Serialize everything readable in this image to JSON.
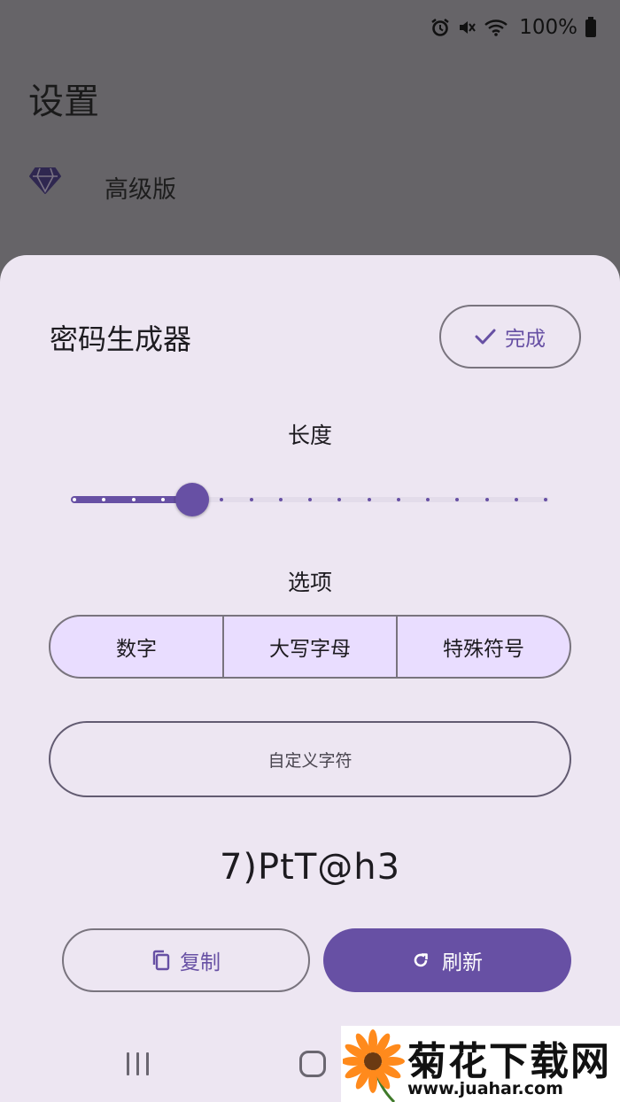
{
  "status_bar": {
    "battery_text": "100%",
    "icons": [
      "alarm-icon",
      "mute-icon",
      "wifi-icon",
      "battery-icon"
    ]
  },
  "settings": {
    "title": "设置",
    "premium_label": "高级版",
    "premium_icon": "diamond-icon"
  },
  "sheet": {
    "title": "密码生成器",
    "done_label": "完成",
    "length_label": "长度",
    "length_slider": {
      "min": 1,
      "max": 17,
      "value": 5
    },
    "options_label": "选项",
    "options": [
      "数字",
      "大写字母",
      "特殊符号"
    ],
    "custom_chars_placeholder": "自定义字符",
    "password": "7)PtT@h3",
    "copy_label": "复制",
    "refresh_label": "刷新"
  },
  "watermark": {
    "title": "菊花下载网",
    "url": "www.juahar.com"
  },
  "colors": {
    "accent": "#6750a4",
    "sheet_bg": "#ede6f2",
    "segment_bg": "#e9ddff",
    "scrim": "#666468"
  }
}
